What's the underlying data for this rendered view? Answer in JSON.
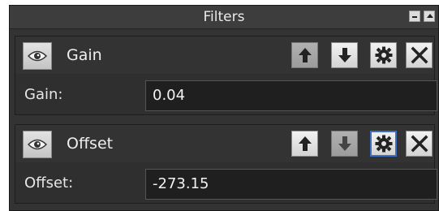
{
  "panel": {
    "title": "Filters"
  },
  "filters": [
    {
      "name": "Gain",
      "param_label": "Gain:",
      "param_value": "0.04"
    },
    {
      "name": "Offset",
      "param_label": "Offset:",
      "param_value": "-273.15"
    }
  ],
  "icons": {
    "visibility": "eye-icon",
    "move_up": "arrow-up-icon",
    "move_down": "arrow-down-icon",
    "settings": "gear-icon",
    "remove": "close-icon"
  }
}
